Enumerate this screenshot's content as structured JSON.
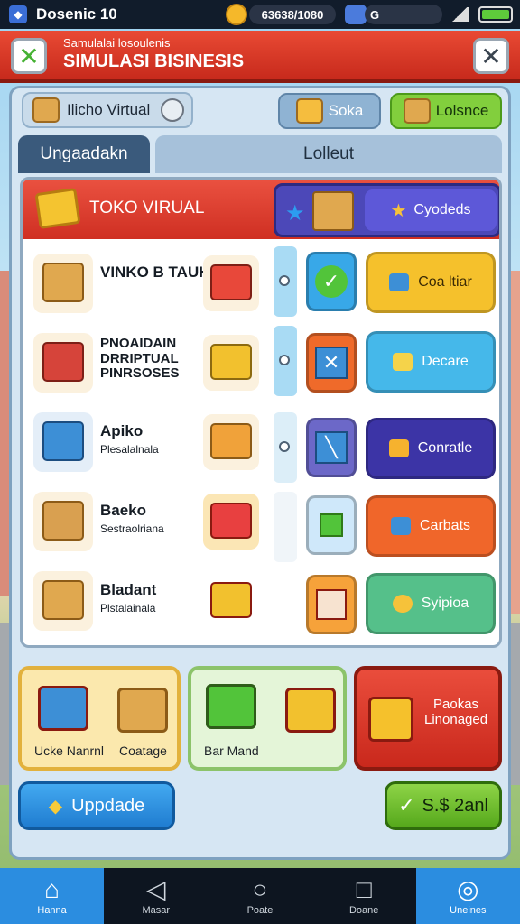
{
  "status_bar": {
    "app_name": "Dosenic 10",
    "coins": "63638/1080",
    "gems": "G",
    "colors": {
      "coin": "#f5b82a",
      "battery": "#5ecb3b"
    }
  },
  "header": {
    "subtitle": "Samulalai losoulenis",
    "title": "SIMULASI BISINESIS",
    "left_icon": "check-icon",
    "right_icon": "close-icon"
  },
  "top_buttons": {
    "store_name": "Ilicho Virtual",
    "stok_label": "Soka",
    "dashboard_label": "Lolsnce"
  },
  "tabs": [
    {
      "label": "Ungaadakn",
      "active": true
    },
    {
      "label": "Lolleut",
      "active": false
    }
  ],
  "card": {
    "title": "TOKO VIRUAL",
    "goods_button": "Cyodeds",
    "products": [
      {
        "name": "VINKO B TAUH",
        "detail": "",
        "icon": "box-icon",
        "side_icon": "shop-stall-icon"
      },
      {
        "name": "PNOAIDAIN\nDRRIPTUAL\nPINRSOSES",
        "detail": "",
        "icon": "store-icon",
        "side_icon": "yellow-store-icon"
      },
      {
        "name": "Apiko",
        "detail": "Plesalalnala",
        "icon": "blue-box-icon",
        "side_icon": "orange-box-icon"
      },
      {
        "name": "Baeko",
        "detail": "Sestraolriana",
        "icon": "boxes-icon",
        "side_icon": "shopping-bag-icon"
      },
      {
        "name": "Bladant",
        "detail": "Plstalainala",
        "icon": "package-icon",
        "side_icon": "cart-icon"
      }
    ],
    "actions": [
      {
        "label": "Coa ltiar",
        "color": "#f5c12c",
        "mini_color": "#38a8e8",
        "mini_icon": "check-icon"
      },
      {
        "label": "Decare",
        "color": "#45b8ea",
        "mini_color": "#ef6a2a",
        "mini_icon": "cross-icon"
      },
      {
        "label": "Conratle",
        "color": "#3c34a6",
        "mini_color": "#6c68c8",
        "mini_icon": "slash-icon"
      },
      {
        "label": "Carbats",
        "color": "#f0662a",
        "mini_color": "#cfe8fa",
        "mini_icon": "green-box-icon"
      },
      {
        "label": "Syipioa",
        "color": "#55c08a",
        "mini_color": "#f6a23a",
        "mini_icon": "open-box-icon"
      }
    ]
  },
  "bottom_cards": {
    "card1": {
      "label1": "Ucke Nanrnl",
      "label2": "Coatage"
    },
    "card2": {
      "label": "Bar Mand"
    },
    "card3": {
      "label": "Paokas\nLinonaged"
    }
  },
  "buttons": {
    "upgrade": "Uppdade",
    "save": "S.$ 2anl"
  },
  "nav": [
    {
      "label": "Hanna",
      "icon": "home-icon",
      "active": true
    },
    {
      "label": "Masar",
      "icon": "back-icon",
      "active": false
    },
    {
      "label": "Poate",
      "icon": "search-icon",
      "active": false
    },
    {
      "label": "Doane",
      "icon": "square-icon",
      "active": false
    },
    {
      "label": "Uneines",
      "icon": "globe-icon",
      "active": true
    }
  ]
}
